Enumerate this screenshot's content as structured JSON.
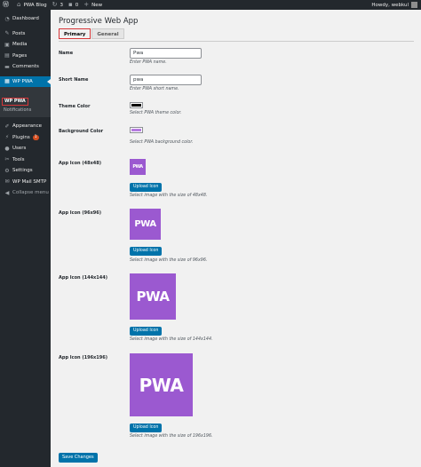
{
  "adminbar": {
    "site_name": "PWA Blog",
    "updates_count": "3",
    "comments_count": "0",
    "new_label": "New",
    "greeting": "Howdy, webkul"
  },
  "sidebar": {
    "dashboard": "Dashboard",
    "posts": "Posts",
    "media": "Media",
    "pages": "Pages",
    "comments": "Comments",
    "wp_pwa": "WP PWA",
    "sub_wp_pwa": "WP PWA",
    "sub_notifications": "Notifications",
    "appearance": "Appearance",
    "plugins": "Plugins",
    "plugins_badge": "1",
    "users": "Users",
    "tools": "Tools",
    "settings": "Settings",
    "wp_mail_smtp": "WP Mail SMTP",
    "collapse": "Collapse menu"
  },
  "page": {
    "title": "Progressive Web App",
    "tabs": [
      "Primary",
      "General"
    ]
  },
  "form": {
    "name_label": "Name",
    "name_value": "Pwa",
    "name_desc": "Enter PWA name.",
    "short_name_label": "Short Name",
    "short_name_value": "pwa",
    "short_name_desc": "Enter PWA short name.",
    "theme_color_label": "Theme Color",
    "theme_color": "#000000",
    "theme_color_desc": "Select PWA theme color.",
    "bg_color_label": "Background Color",
    "bg_color": "#b57be0",
    "bg_color_desc": "Select PWA background color.",
    "icon_text": "PWA",
    "icons": [
      {
        "label": "App Icon (48x48)",
        "button": "Upload Icon",
        "desc": "Select image with the size of 48x48."
      },
      {
        "label": "App Icon (96x96)",
        "button": "Upload Icon",
        "desc": "Select image with the size of 96x96."
      },
      {
        "label": "App Icon (144x144)",
        "button": "Upload Icon",
        "desc": "Select image with the size of 144x144."
      },
      {
        "label": "App Icon (196x196)",
        "button": "Upload Icon",
        "desc": "Select image with the size of 196x196."
      }
    ],
    "save_label": "Save Changes"
  },
  "colors": {
    "accent": "#0073aa",
    "pwa_icon_bg": "#9b59d0",
    "sidebar_bg": "#23282d"
  }
}
